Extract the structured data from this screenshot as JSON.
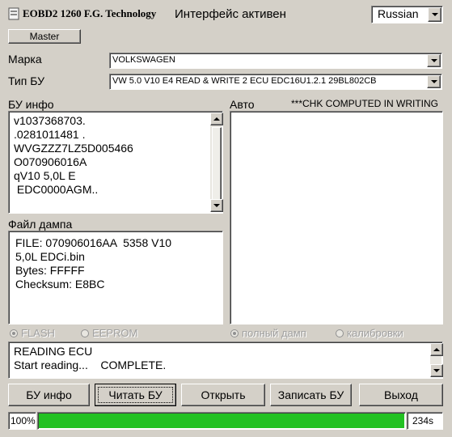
{
  "header": {
    "app_title": "EOBD2 1260 F.G. Technology",
    "status": "Интерфейс активен",
    "language": "Russian",
    "master_label": "Master"
  },
  "fields": {
    "brand_label": "Марка",
    "brand_value": "VOLKSWAGEN",
    "ecu_type_label": "Тип БУ",
    "ecu_type_value": "VW 5.0 V10 E4 READ & WRITE 2 ECU EDC16U1.2.1 29BL802CB"
  },
  "ecu_info": {
    "label": "БУ инфо",
    "lines": [
      "v1037368703.",
      ".0281011481 .",
      "WVGZZZ7LZ5D005466",
      "O070906016A",
      "qV10 5,0L E",
      " EDC0000AGM.."
    ]
  },
  "auto": {
    "label": "Авто",
    "note": "***CHK COMPUTED IN WRITING"
  },
  "dump": {
    "label": "Файл дампа",
    "lines": [
      "FILE: 070906016AA  5358 V10",
      "5,0L EDCi.bin",
      "Bytes: FFFFF",
      "Checksum: E8BC"
    ]
  },
  "radios": {
    "flash": "FLASH",
    "eeprom": "EEPROM",
    "full_dump": "полный дамп",
    "calibration": "калибровки"
  },
  "log": {
    "lines": [
      "READING ECU",
      "Start reading...    COMPLETE."
    ]
  },
  "buttons": {
    "ecu_info": "БУ инфо",
    "read": "Читать БУ",
    "open": "Открыть",
    "write": "Записать БУ",
    "exit": "Выход"
  },
  "progress": {
    "percent_label": "100%",
    "value": 1.0,
    "time": "234s",
    "fill_color": "#22c122"
  }
}
